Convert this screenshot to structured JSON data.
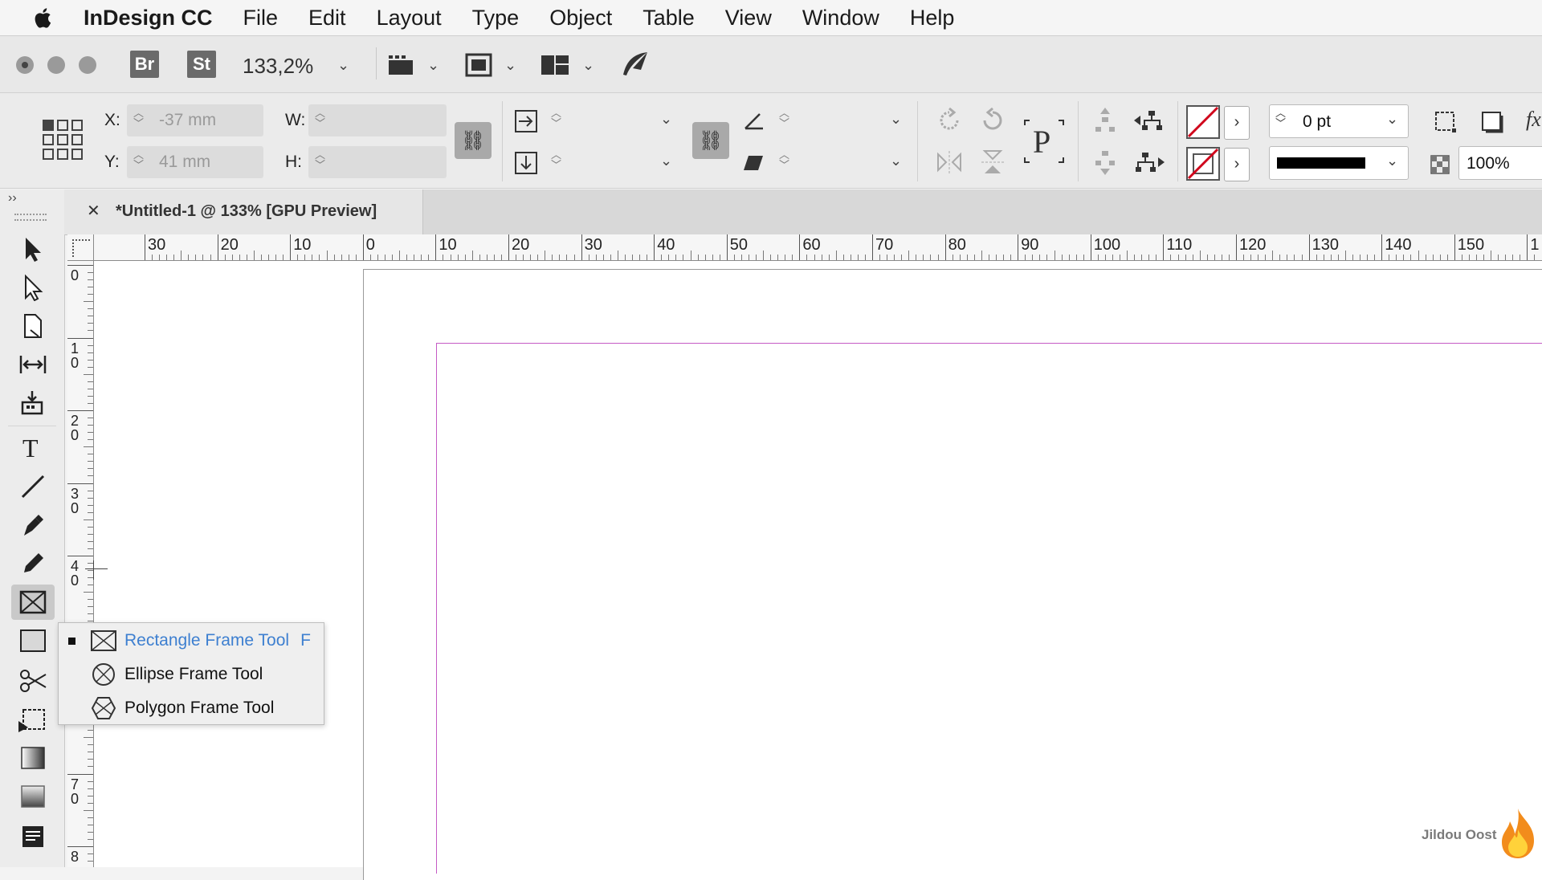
{
  "menubar": {
    "app_name": "InDesign CC",
    "items": [
      "File",
      "Edit",
      "Layout",
      "Type",
      "Object",
      "Table",
      "View",
      "Window",
      "Help"
    ]
  },
  "appbar": {
    "bridge_label": "Br",
    "stock_label": "St",
    "zoom_value": "133,2%"
  },
  "control": {
    "x_label": "X:",
    "y_label": "Y:",
    "w_label": "W:",
    "h_label": "H:",
    "x_value": "-37 mm",
    "y_value": "41 mm",
    "stroke_weight": "0 pt",
    "opacity": "100%",
    "effects_label": "fx"
  },
  "document": {
    "tab_title": "*Untitled-1 @ 133% [GPU Preview]",
    "close_glyph": "✕"
  },
  "rulers": {
    "horizontal": [
      "30",
      "20",
      "10",
      "0",
      "10",
      "20",
      "30",
      "40",
      "50",
      "60",
      "70",
      "80",
      "90",
      "100",
      "110",
      "120",
      "130",
      "140",
      "150",
      "1"
    ],
    "vertical": [
      "0",
      "1\n0",
      "2\n0",
      "3\n0",
      "4\n0",
      "",
      "0",
      "7\n0",
      "8"
    ]
  },
  "flyout": {
    "items": [
      {
        "label": "Rectangle Frame Tool",
        "shortcut": "F",
        "selected": true
      },
      {
        "label": "Ellipse Frame Tool",
        "shortcut": "",
        "selected": false
      },
      {
        "label": "Polygon Frame Tool",
        "shortcut": "",
        "selected": false
      }
    ]
  },
  "watermark": "Jildou Oost",
  "colors": {
    "margin_guide": "#c55bc5",
    "flyout_selected_text": "#3d7fd0",
    "stroke_none_red": "#d0021b"
  }
}
